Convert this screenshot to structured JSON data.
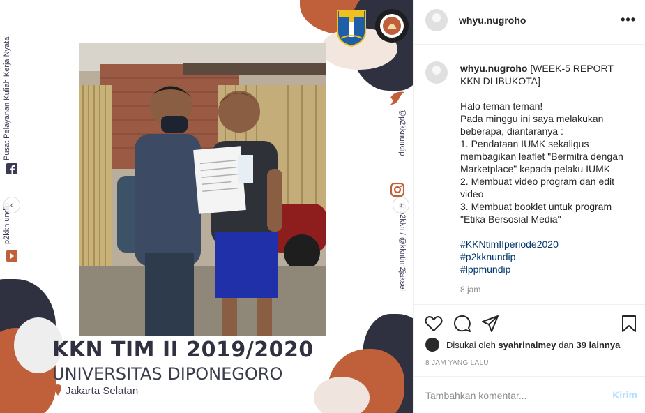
{
  "post_image": {
    "side_left_text_top": "Pusat Pelayanan Kuliah Kerja Nyata",
    "side_left_text_bottom": "p2kkn undip",
    "side_right_text_top": "@p2kknundip",
    "side_right_text_bottom": "@p2kkn / @kkntim2jaksel",
    "title": "KKN TIM II 2019/2020",
    "subtitle": "UNIVERSITAS DIPONEGORO",
    "location": "Jakarta Selatan",
    "logo_left_text": "JAYA RAYA",
    "logo_right_text": "UNIVERSITAS DIPONEGORO SEMARANG"
  },
  "header": {
    "username": "whyu.nugroho",
    "more_icon": "more-horizontal-icon"
  },
  "caption": {
    "username": "whyu.nugroho",
    "lines": [
      "[WEEK-5 REPORT KKN DI IBUKOTA]",
      "",
      "Halo teman teman!",
      "Pada minggu ini saya melakukan beberapa, diantaranya :",
      "1. Pendataan IUMK sekaligus membagikan leaflet \"Bermitra dengan Marketplace\" kepada pelaku IUMK",
      "2. Membuat video program dan edit video",
      "3. Membuat booklet untuk program \"Etika Bersosial Media\"",
      ""
    ],
    "hashtags": [
      "#KKNtimIIperiode2020",
      "#p2kknundip",
      "#lppmundip"
    ],
    "time": "8 jam"
  },
  "actions": {
    "icons": [
      "heart-icon",
      "comment-icon",
      "share-icon",
      "bookmark-icon"
    ]
  },
  "likes": {
    "prefix": "Disukai oleh ",
    "user": "syahrinalmey",
    "middle": " dan ",
    "others": "39 lainnya"
  },
  "timestamp": "8 JAM YANG LALU",
  "comment_box": {
    "placeholder": "Tambahkan komentar...",
    "post_label": "Kirim"
  },
  "colors": {
    "accent_brown": "#c0603a",
    "navy": "#2f3140",
    "hashtag_blue": "#00376b",
    "post_button_disabled": "#b2dffc"
  }
}
